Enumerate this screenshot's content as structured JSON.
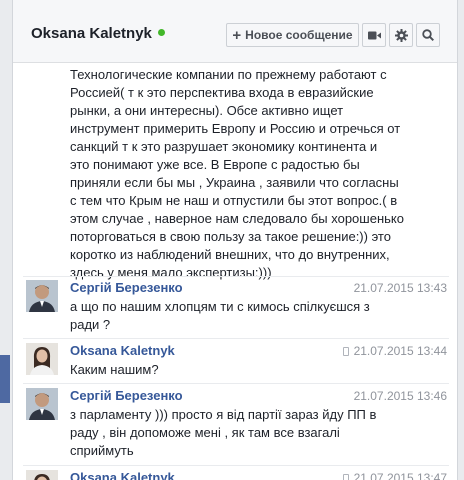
{
  "header": {
    "title": "Oksana Kaletnyk",
    "new_message_label": "Новое сообщение",
    "icons": [
      "plus-icon",
      "video-icon",
      "gear-icon",
      "search-icon"
    ]
  },
  "thread": {
    "continued_text": "Технологические компании по прежнему работают с\nРоссией( т к это перспектива входа в евразийские\nрынки, а они интересны). Обсе активно ищет\nинструмент примерить Европу и Россию и отречься от\nсанкций т к это разрушает экономику континента и\nэто понимают уже все. В Европе с радостью бы\nприняли если бы мы , Украина , заявили что согласны\nс тем что Крым не наш и отпустили бы этот вопрос.( в\nэтом случае , наверное нам следовало бы хорошенько\nпоторговаться в свою пользу за такое решение:)) это\nкоротко из наблюдений внешних, что до внутренних,\nздесь у меня мало экспертизы:)))",
    "messages": [
      {
        "sender": "Сергій Березенко",
        "time": "21.07.2015 13:43",
        "mobile": false,
        "text": "а що по нашим хлопцям ти с кимось спілкуєшся з\nради ?"
      },
      {
        "sender": "Oksana Kaletnyk",
        "time": "21.07.2015 13:44",
        "mobile": true,
        "text": "Каким нашим?"
      },
      {
        "sender": "Сергій Березенко",
        "time": "21.07.2015 13:46",
        "mobile": false,
        "text": "з парламенту ))) просто я від партії зараз йду ПП в\nраду , він допоможе мені , як там все взагалі\nсприймуть"
      },
      {
        "sender": "Oksana Kaletnyk",
        "time": "21.07.2015 13:47",
        "mobile": true,
        "text": ""
      }
    ]
  },
  "colors": {
    "link_blue": "#365899",
    "online_green": "#42b72a",
    "timestamp_gray": "#90949c"
  }
}
